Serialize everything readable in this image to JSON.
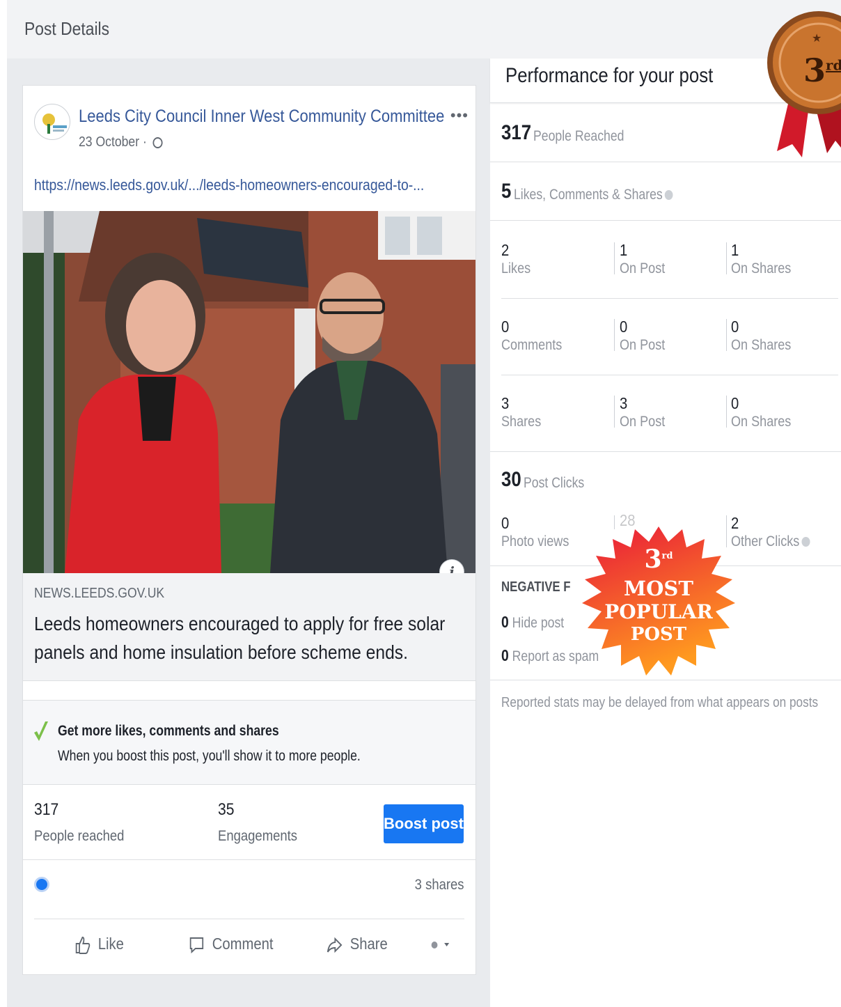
{
  "page": {
    "title": "Post Details"
  },
  "post": {
    "page_name": "Leeds City Council Inner West Community Committee",
    "date": "23 October ·",
    "link": "https://news.leeds.gov.uk/.../leeds-homeowners-encouraged-to-...",
    "more": "•••",
    "info_glyph": "i"
  },
  "link_preview": {
    "domain": "NEWS.LEEDS.GOV.UK",
    "headline": "Leeds homeowners encouraged to apply for free solar panels and home insulation before scheme ends."
  },
  "boost_promo": {
    "title": "Get more likes, comments and shares",
    "subtitle": "When you boost this post, you'll show it to more people."
  },
  "stats": {
    "reached_value": "317",
    "reached_label": "People reached",
    "engagements_value": "35",
    "engagements_label": "Engagements",
    "boost_button": "Boost post"
  },
  "reactions": {
    "shares": "3 shares"
  },
  "actions": {
    "like": "Like",
    "comment": "Comment",
    "share": "Share"
  },
  "performance": {
    "title": "Performance for your post",
    "reached_value": "317",
    "reached_label": "People Reached",
    "engagement_value": "5",
    "engagement_label": "Likes, Comments & Shares",
    "rows": [
      {
        "total": "2",
        "total_label": "Likes",
        "post": "1",
        "post_label": "On Post",
        "shares": "1",
        "shares_label": "On Shares"
      },
      {
        "total": "0",
        "total_label": "Comments",
        "post": "0",
        "post_label": "On Post",
        "shares": "0",
        "shares_label": "On Shares"
      },
      {
        "total": "3",
        "total_label": "Shares",
        "post": "3",
        "post_label": "On Post",
        "shares": "0",
        "shares_label": "On Shares"
      }
    ],
    "clicks_value": "30",
    "clicks_label": "Post Clicks",
    "photo_views_value": "0",
    "photo_views_label": "Photo views",
    "link_clicks_value": "28",
    "other_clicks_value": "2",
    "other_clicks_label": "Other Clicks",
    "negative_title": "NEGATIVE F",
    "hide_value": "0",
    "hide_label": "Hide post",
    "spam_value": "0",
    "spam_label": "Report as spam",
    "footnote": "Reported stats may be delayed from what appears on posts"
  },
  "overlay": {
    "burst_rank": "3",
    "burst_suffix": "rd",
    "burst_line1": "MOST",
    "burst_line2": "POPULAR",
    "burst_line3": "POST",
    "medal_rank": "3",
    "medal_suffix": "rd",
    "burst_color_top": "#e8173a",
    "burst_color_bottom": "#ff9a1f",
    "medal_color": "#c9742e"
  },
  "colors": {
    "accent": "#1877f2",
    "link": "#365899"
  }
}
